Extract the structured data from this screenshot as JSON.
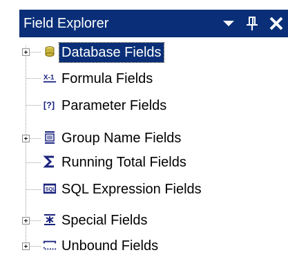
{
  "panel": {
    "title": "Field Explorer",
    "buttons": {
      "dropdown_icon": "chevron-down-icon",
      "pin_icon": "pin-icon",
      "close_icon": "close-icon"
    },
    "colors": {
      "titlebar_bg": "#0a2f78",
      "selection_bg": "#0a2f78"
    }
  },
  "tree": {
    "items": [
      {
        "label": "Database Fields",
        "icon": "database-icon",
        "expandable": true,
        "selected": true
      },
      {
        "label": "Formula Fields",
        "icon": "formula-icon",
        "expandable": false,
        "selected": false
      },
      {
        "label": "Parameter Fields",
        "icon": "parameter-icon",
        "expandable": false,
        "selected": false
      },
      {
        "label": "Group Name Fields",
        "icon": "group-name-icon",
        "expandable": true,
        "selected": false
      },
      {
        "label": "Running Total Fields",
        "icon": "sigma-icon",
        "expandable": false,
        "selected": false
      },
      {
        "label": "SQL Expression Fields",
        "icon": "sql-icon",
        "expandable": false,
        "selected": false
      },
      {
        "label": "Special Fields",
        "icon": "special-fields-icon",
        "expandable": true,
        "selected": false
      },
      {
        "label": "Unbound Fields",
        "icon": "unbound-icon",
        "expandable": true,
        "selected": false
      }
    ],
    "icon_texts": {
      "formula": "X-1",
      "parameter": "[?]",
      "sql": "SQL"
    }
  }
}
